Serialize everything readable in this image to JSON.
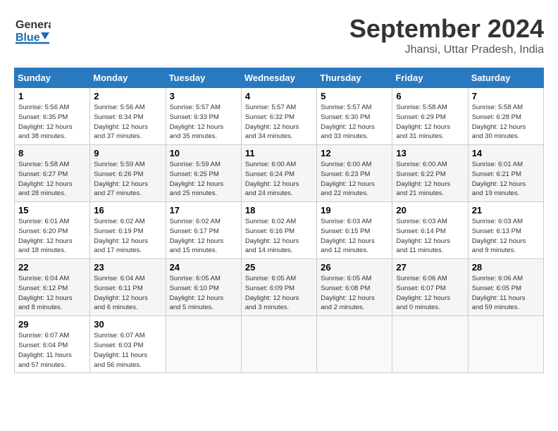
{
  "header": {
    "logo_line1": "General",
    "logo_line2": "Blue",
    "month": "September 2024",
    "location": "Jhansi, Uttar Pradesh, India"
  },
  "weekdays": [
    "Sunday",
    "Monday",
    "Tuesday",
    "Wednesday",
    "Thursday",
    "Friday",
    "Saturday"
  ],
  "weeks": [
    [
      {
        "day": "1",
        "info": "Sunrise: 5:56 AM\nSunset: 6:35 PM\nDaylight: 12 hours\nand 38 minutes."
      },
      {
        "day": "2",
        "info": "Sunrise: 5:56 AM\nSunset: 6:34 PM\nDaylight: 12 hours\nand 37 minutes."
      },
      {
        "day": "3",
        "info": "Sunrise: 5:57 AM\nSunset: 6:33 PM\nDaylight: 12 hours\nand 35 minutes."
      },
      {
        "day": "4",
        "info": "Sunrise: 5:57 AM\nSunset: 6:32 PM\nDaylight: 12 hours\nand 34 minutes."
      },
      {
        "day": "5",
        "info": "Sunrise: 5:57 AM\nSunset: 6:30 PM\nDaylight: 12 hours\nand 33 minutes."
      },
      {
        "day": "6",
        "info": "Sunrise: 5:58 AM\nSunset: 6:29 PM\nDaylight: 12 hours\nand 31 minutes."
      },
      {
        "day": "7",
        "info": "Sunrise: 5:58 AM\nSunset: 6:28 PM\nDaylight: 12 hours\nand 30 minutes."
      }
    ],
    [
      {
        "day": "8",
        "info": "Sunrise: 5:58 AM\nSunset: 6:27 PM\nDaylight: 12 hours\nand 28 minutes."
      },
      {
        "day": "9",
        "info": "Sunrise: 5:59 AM\nSunset: 6:26 PM\nDaylight: 12 hours\nand 27 minutes."
      },
      {
        "day": "10",
        "info": "Sunrise: 5:59 AM\nSunset: 6:25 PM\nDaylight: 12 hours\nand 25 minutes."
      },
      {
        "day": "11",
        "info": "Sunrise: 6:00 AM\nSunset: 6:24 PM\nDaylight: 12 hours\nand 24 minutes."
      },
      {
        "day": "12",
        "info": "Sunrise: 6:00 AM\nSunset: 6:23 PM\nDaylight: 12 hours\nand 22 minutes."
      },
      {
        "day": "13",
        "info": "Sunrise: 6:00 AM\nSunset: 6:22 PM\nDaylight: 12 hours\nand 21 minutes."
      },
      {
        "day": "14",
        "info": "Sunrise: 6:01 AM\nSunset: 6:21 PM\nDaylight: 12 hours\nand 19 minutes."
      }
    ],
    [
      {
        "day": "15",
        "info": "Sunrise: 6:01 AM\nSunset: 6:20 PM\nDaylight: 12 hours\nand 18 minutes."
      },
      {
        "day": "16",
        "info": "Sunrise: 6:02 AM\nSunset: 6:19 PM\nDaylight: 12 hours\nand 17 minutes."
      },
      {
        "day": "17",
        "info": "Sunrise: 6:02 AM\nSunset: 6:17 PM\nDaylight: 12 hours\nand 15 minutes."
      },
      {
        "day": "18",
        "info": "Sunrise: 6:02 AM\nSunset: 6:16 PM\nDaylight: 12 hours\nand 14 minutes."
      },
      {
        "day": "19",
        "info": "Sunrise: 6:03 AM\nSunset: 6:15 PM\nDaylight: 12 hours\nand 12 minutes."
      },
      {
        "day": "20",
        "info": "Sunrise: 6:03 AM\nSunset: 6:14 PM\nDaylight: 12 hours\nand 11 minutes."
      },
      {
        "day": "21",
        "info": "Sunrise: 6:03 AM\nSunset: 6:13 PM\nDaylight: 12 hours\nand 9 minutes."
      }
    ],
    [
      {
        "day": "22",
        "info": "Sunrise: 6:04 AM\nSunset: 6:12 PM\nDaylight: 12 hours\nand 8 minutes."
      },
      {
        "day": "23",
        "info": "Sunrise: 6:04 AM\nSunset: 6:11 PM\nDaylight: 12 hours\nand 6 minutes."
      },
      {
        "day": "24",
        "info": "Sunrise: 6:05 AM\nSunset: 6:10 PM\nDaylight: 12 hours\nand 5 minutes."
      },
      {
        "day": "25",
        "info": "Sunrise: 6:05 AM\nSunset: 6:09 PM\nDaylight: 12 hours\nand 3 minutes."
      },
      {
        "day": "26",
        "info": "Sunrise: 6:05 AM\nSunset: 6:08 PM\nDaylight: 12 hours\nand 2 minutes."
      },
      {
        "day": "27",
        "info": "Sunrise: 6:06 AM\nSunset: 6:07 PM\nDaylight: 12 hours\nand 0 minutes."
      },
      {
        "day": "28",
        "info": "Sunrise: 6:06 AM\nSunset: 6:05 PM\nDaylight: 11 hours\nand 59 minutes."
      }
    ],
    [
      {
        "day": "29",
        "info": "Sunrise: 6:07 AM\nSunset: 6:04 PM\nDaylight: 11 hours\nand 57 minutes."
      },
      {
        "day": "30",
        "info": "Sunrise: 6:07 AM\nSunset: 6:03 PM\nDaylight: 11 hours\nand 56 minutes."
      },
      {
        "day": "",
        "info": ""
      },
      {
        "day": "",
        "info": ""
      },
      {
        "day": "",
        "info": ""
      },
      {
        "day": "",
        "info": ""
      },
      {
        "day": "",
        "info": ""
      }
    ]
  ]
}
